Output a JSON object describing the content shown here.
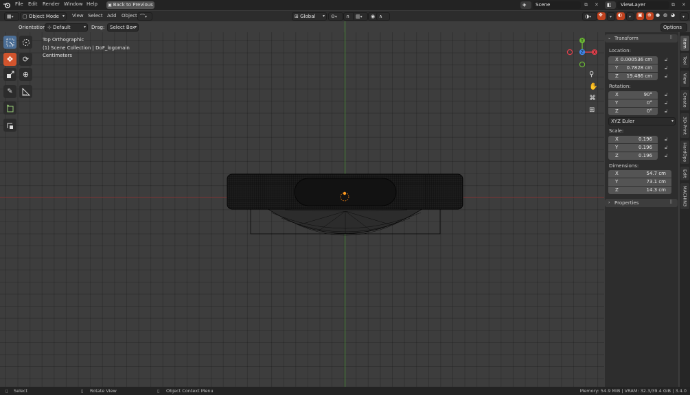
{
  "topbar": {
    "menus": [
      "File",
      "Edit",
      "Render",
      "Window",
      "Help"
    ],
    "back_button": "Back to Previous",
    "scene_name": "Scene",
    "view_layer": "ViewLayer"
  },
  "viewport_header": {
    "mode": "Object Mode",
    "menus": [
      "View",
      "Select",
      "Add",
      "Object"
    ],
    "transform_orientation": "Global"
  },
  "tool_settings": {
    "orientation_label": "Orientation:",
    "orientation_value": "Default",
    "drag_label": "Drag:",
    "drag_value": "Select Box",
    "options_label": "Options"
  },
  "viewport_info": {
    "view_name": "Top Orthographic",
    "collection": "(1) Scene Collection | DoF_logomain",
    "units": "Centimeters"
  },
  "gizmo": {
    "x": "X",
    "y": "Y",
    "z": "Z"
  },
  "npanel": {
    "transform_title": "Transform",
    "location_label": "Location:",
    "location": [
      {
        "axis": "X",
        "value": "0.000536 cm"
      },
      {
        "axis": "Y",
        "value": "0.7828 cm"
      },
      {
        "axis": "Z",
        "value": "19.486 cm"
      }
    ],
    "rotation_label": "Rotation:",
    "rotation": [
      {
        "axis": "X",
        "value": "90°"
      },
      {
        "axis": "Y",
        "value": "0°"
      },
      {
        "axis": "Z",
        "value": "0°"
      }
    ],
    "rotation_mode": "XYZ Euler",
    "scale_label": "Scale:",
    "scale": [
      {
        "axis": "X",
        "value": "0.196"
      },
      {
        "axis": "Y",
        "value": "0.196"
      },
      {
        "axis": "Z",
        "value": "0.196"
      }
    ],
    "dimensions_label": "Dimensions:",
    "dimensions": [
      {
        "axis": "X",
        "value": "54.7 cm"
      },
      {
        "axis": "Y",
        "value": "73.1 cm"
      },
      {
        "axis": "Z",
        "value": "14.3 cm"
      }
    ],
    "properties_title": "Properties",
    "tabs": [
      "Item",
      "Tool",
      "View",
      "Create",
      "3D-Print",
      "HardOps",
      "Edit",
      "MACHIN3"
    ]
  },
  "statusbar": {
    "select": "Select",
    "rotate_view": "Rotate View",
    "context_menu": "Object Context Menu",
    "memory": "Memory: 54.9 MiB | VRAM: 32.3/39.4 GiB | 3.4.0"
  },
  "colors": {
    "accent_orange": "#d2542d",
    "active_blue": "#4b6e96",
    "x_axis": "#e0404c",
    "y_axis": "#6bb935",
    "z_axis": "#3f86e8"
  }
}
